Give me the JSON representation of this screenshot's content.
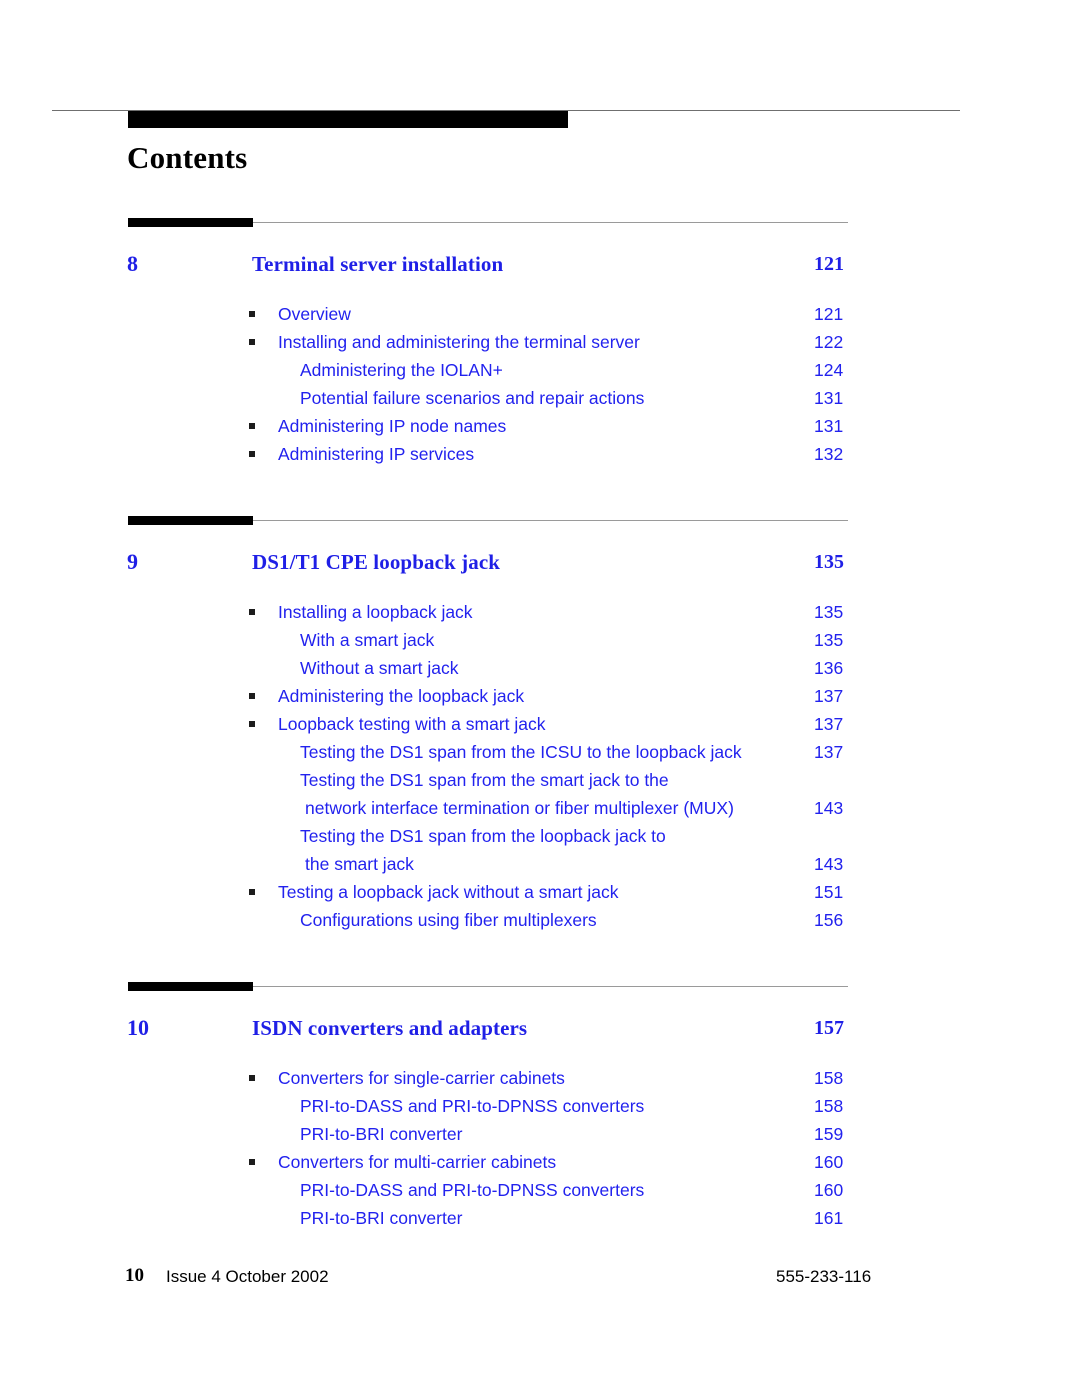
{
  "document": {
    "page_title": "Contents",
    "accent_blue": "#2222EE",
    "heading_blue": "#1F1FE6",
    "rule_black": "#000000",
    "rule_gray": "#9A9A9A"
  },
  "chapters": [
    {
      "number": "8",
      "title": "Terminal server installation",
      "page": "121",
      "entries": [
        {
          "level": 1,
          "bullet": true,
          "lines": [
            "Overview"
          ],
          "page": "121"
        },
        {
          "level": 1,
          "bullet": true,
          "lines": [
            "Installing and administering the terminal server"
          ],
          "page": "122"
        },
        {
          "level": 2,
          "bullet": false,
          "lines": [
            "Administering the IOLAN+"
          ],
          "page": "124"
        },
        {
          "level": 2,
          "bullet": false,
          "lines": [
            "Potential failure scenarios and repair actions"
          ],
          "page": "131"
        },
        {
          "level": 1,
          "bullet": true,
          "lines": [
            "Administering IP node names"
          ],
          "page": "131"
        },
        {
          "level": 1,
          "bullet": true,
          "lines": [
            "Administering IP services"
          ],
          "page": "132"
        }
      ]
    },
    {
      "number": "9",
      "title": "DS1/T1 CPE loopback jack",
      "page": "135",
      "entries": [
        {
          "level": 1,
          "bullet": true,
          "lines": [
            "Installing a loopback jack"
          ],
          "page": "135"
        },
        {
          "level": 2,
          "bullet": false,
          "lines": [
            "With a smart jack"
          ],
          "page": "135"
        },
        {
          "level": 2,
          "bullet": false,
          "lines": [
            "Without a smart jack"
          ],
          "page": "136"
        },
        {
          "level": 1,
          "bullet": true,
          "lines": [
            "Administering the loopback jack"
          ],
          "page": "137"
        },
        {
          "level": 1,
          "bullet": true,
          "lines": [
            "Loopback testing with a smart jack"
          ],
          "page": "137"
        },
        {
          "level": 2,
          "bullet": false,
          "lines": [
            "Testing the DS1 span from the ICSU to the loopback jack"
          ],
          "page": "137"
        },
        {
          "level": 2,
          "bullet": false,
          "lines": [
            "Testing the DS1 span from the smart jack to the",
            "network interface termination or fiber multiplexer (MUX)"
          ],
          "page": "143"
        },
        {
          "level": 2,
          "bullet": false,
          "lines": [
            "Testing the DS1 span from the loopback jack to",
            "the smart jack"
          ],
          "page": "143"
        },
        {
          "level": 1,
          "bullet": true,
          "lines": [
            "Testing a loopback jack without a smart jack"
          ],
          "page": "151"
        },
        {
          "level": 2,
          "bullet": false,
          "lines": [
            "Configurations using fiber multiplexers"
          ],
          "page": "156"
        }
      ]
    },
    {
      "number": "10",
      "title": "ISDN converters and adapters",
      "page": "157",
      "entries": [
        {
          "level": 1,
          "bullet": true,
          "lines": [
            "Converters for single-carrier cabinets"
          ],
          "page": "158"
        },
        {
          "level": 2,
          "bullet": false,
          "lines": [
            "PRI-to-DASS and PRI-to-DPNSS converters"
          ],
          "page": "158"
        },
        {
          "level": 2,
          "bullet": false,
          "lines": [
            "PRI-to-BRI converter"
          ],
          "page": "159"
        },
        {
          "level": 1,
          "bullet": true,
          "lines": [
            "Converters for multi-carrier cabinets"
          ],
          "page": "160"
        },
        {
          "level": 2,
          "bullet": false,
          "lines": [
            "PRI-to-DASS and PRI-to-DPNSS converters"
          ],
          "page": "160"
        },
        {
          "level": 2,
          "bullet": false,
          "lines": [
            "PRI-to-BRI converter"
          ],
          "page": "161"
        }
      ]
    }
  ],
  "footer": {
    "page_number": "10",
    "issue": "Issue 4   October 2002",
    "doc_number": "555-233-116"
  }
}
